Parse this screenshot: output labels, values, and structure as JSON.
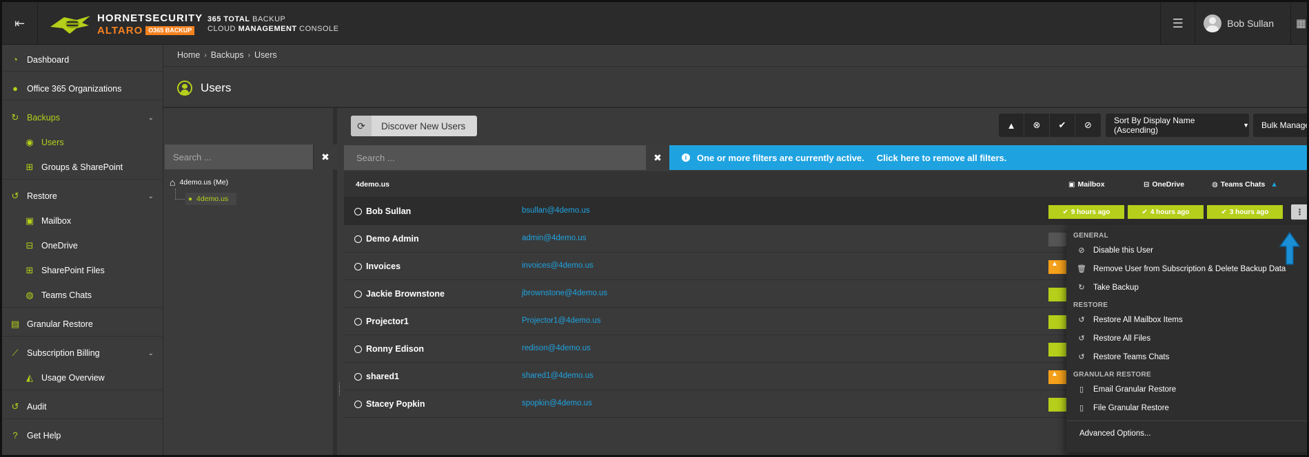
{
  "header": {
    "logo_hornet": "HORNETSECURITY",
    "logo_altaro": "ALTARO",
    "logo_badge": "O365 BACKUP",
    "product_line1_bold": "365 TOTAL",
    "product_line1_rest": " BACKUP",
    "product_line2_a": "CLOUD ",
    "product_line2_bold": "MANAGEMENT",
    "product_line2_b": " CONSOLE",
    "user_name": "Bob Sullan"
  },
  "sidebar": {
    "items": [
      {
        "label": "Dashboard",
        "icon": "dashboard-icon"
      },
      {
        "label": "Office 365 Organizations",
        "icon": "globe-icon"
      },
      {
        "label": "Backups",
        "icon": "refresh-icon"
      },
      {
        "label": "Users",
        "icon": "user-circle-icon"
      },
      {
        "label": "Groups & SharePoint",
        "icon": "sitemap-icon"
      },
      {
        "label": "Restore",
        "icon": "history-icon"
      },
      {
        "label": "Mailbox",
        "icon": "inbox-icon"
      },
      {
        "label": "OneDrive",
        "icon": "drive-icon"
      },
      {
        "label": "SharePoint Files",
        "icon": "sitemap-icon"
      },
      {
        "label": "Teams Chats",
        "icon": "chat-icon"
      },
      {
        "label": "Granular Restore",
        "icon": "file-icon"
      },
      {
        "label": "Subscription Billing",
        "icon": "chart-line-icon"
      },
      {
        "label": "Usage Overview",
        "icon": "area-chart-icon"
      },
      {
        "label": "Audit",
        "icon": "history-icon"
      },
      {
        "label": "Get Help",
        "icon": "question-icon"
      }
    ]
  },
  "breadcrumb": [
    "Home",
    "Backups",
    "Users"
  ],
  "page_title": "Users",
  "tree": {
    "search_placeholder": "Search ...",
    "root": "4demo.us (Me)",
    "child": "4demo.us"
  },
  "toolbar": {
    "discover_label": "Discover New Users",
    "sort_label": "Sort By Display Name (Ascending)",
    "bulk_label": "Bulk Manage"
  },
  "users_search_placeholder": "Search ...",
  "filter_banner": {
    "message": "One or more filters are currently active.",
    "link": "Click here to remove all filters."
  },
  "table": {
    "org": "4demo.us",
    "columns": [
      "Mailbox",
      "OneDrive",
      "Teams Chats"
    ],
    "rows": [
      {
        "name": "Bob Sullan",
        "email": "bsullan@4demo.us",
        "mailbox": "9 hours ago",
        "onedrive": "4 hours ago",
        "teams": "3 hours ago"
      },
      {
        "name": "Demo Admin",
        "email": "admin@4demo.us"
      },
      {
        "name": "Invoices",
        "email": "invoices@4demo.us"
      },
      {
        "name": "Jackie Brownstone",
        "email": "jbrownstone@4demo.us"
      },
      {
        "name": "Projector1",
        "email": "Projector1@4demo.us"
      },
      {
        "name": "Ronny Edison",
        "email": "redison@4demo.us"
      },
      {
        "name": "shared1",
        "email": "shared1@4demo.us"
      },
      {
        "name": "Stacey Popkin",
        "email": "spopkin@4demo.us"
      }
    ]
  },
  "dropdown": {
    "general_header": "GENERAL",
    "disable_user": "Disable this User",
    "remove_user": "Remove User from Subscription & Delete Backup Data",
    "take_backup": "Take Backup",
    "restore_header": "RESTORE",
    "restore_mailbox": "Restore All Mailbox Items",
    "restore_files": "Restore All Files",
    "restore_teams": "Restore Teams Chats",
    "granular_header": "GRANULAR RESTORE",
    "email_granular": "Email Granular Restore",
    "file_granular": "File Granular Restore",
    "advanced": "Advanced Options..."
  },
  "colors": {
    "accent": "#b5cf1a",
    "info": "#1fa3e0",
    "warning": "#f5a11b",
    "brand_orange": "#f58220"
  }
}
